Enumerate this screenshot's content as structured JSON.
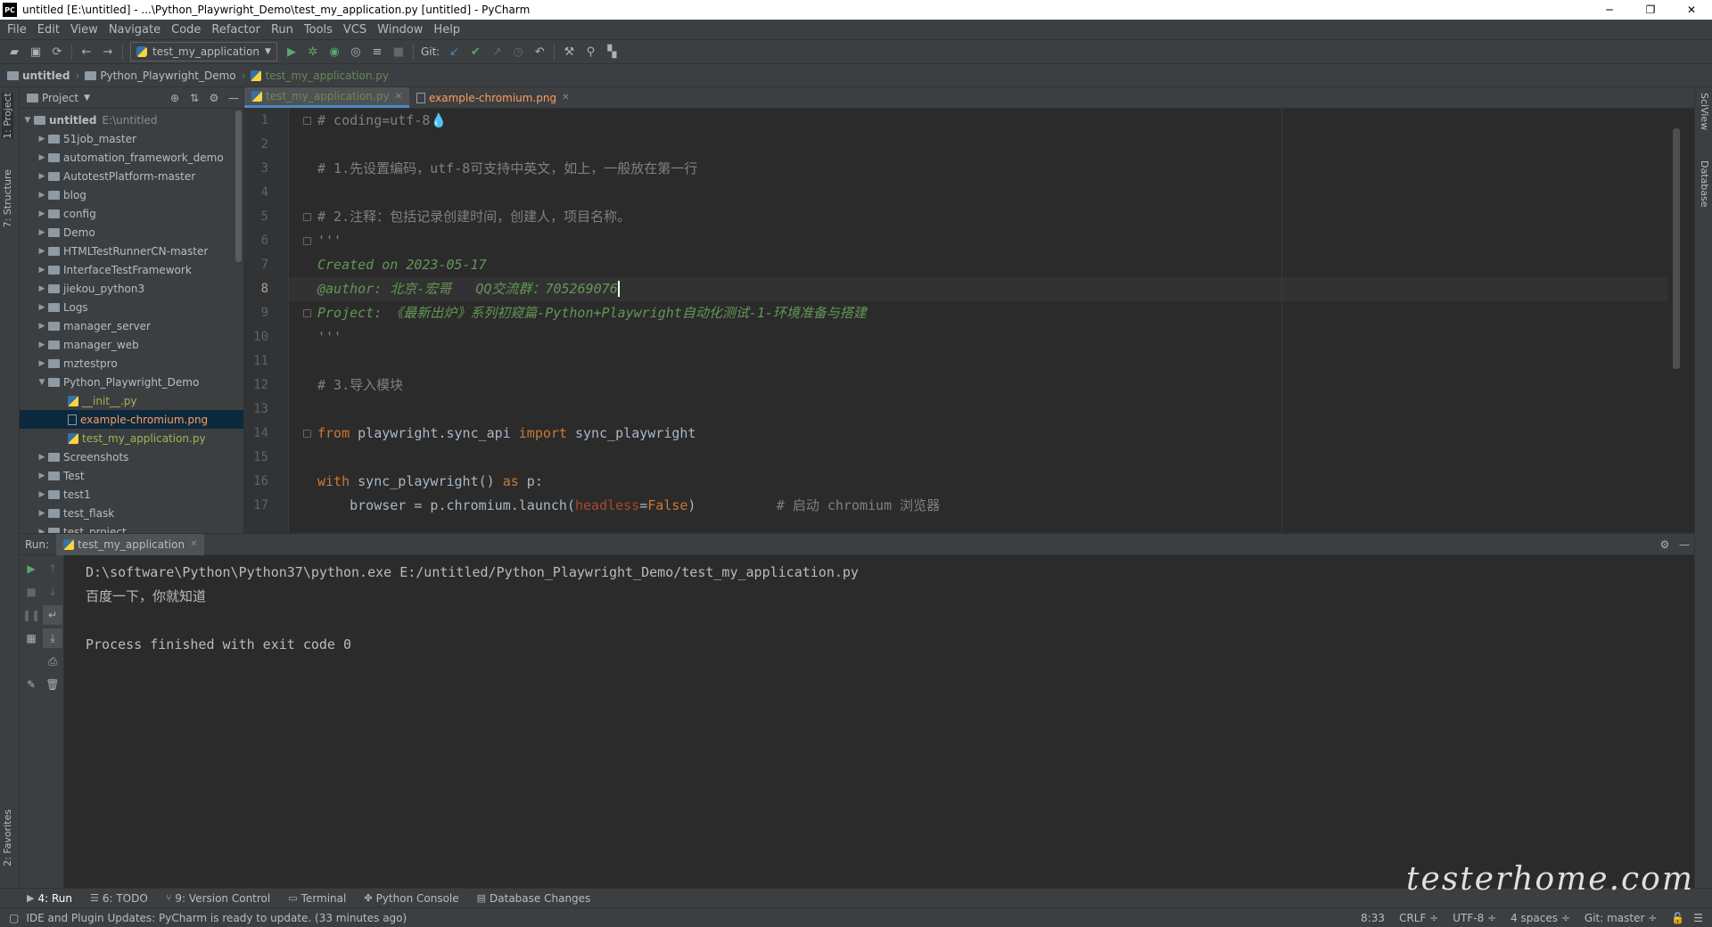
{
  "window": {
    "title": "untitled [E:\\untitled] - ...\\Python_Playwright_Demo\\test_my_application.py [untitled] - PyCharm",
    "icon_text": "PC",
    "minimize": "─",
    "maximize": "❐",
    "close": "✕"
  },
  "menu": [
    "File",
    "Edit",
    "View",
    "Navigate",
    "Code",
    "Refactor",
    "Run",
    "Tools",
    "VCS",
    "Window",
    "Help"
  ],
  "toolbar": {
    "run_config": "test_my_application",
    "git_label": "Git:"
  },
  "breadcrumb": [
    "untitled",
    "Python_Playwright_Demo",
    "test_my_application.py"
  ],
  "left_strip": {
    "project": "1: Project",
    "structure": "7: Structure",
    "favorites": "2: Favorites"
  },
  "right_strip": {
    "sciview": "SciView",
    "database": "Database"
  },
  "project_panel": {
    "title": "Project",
    "root": {
      "name": "untitled",
      "path": "E:\\untitled"
    },
    "items": [
      "51job_master",
      "automation_framework_demo",
      "AutotestPlatform-master",
      "blog",
      "config",
      "Demo",
      "HTMLTestRunnerCN-master",
      "InterfaceTestFramework",
      "jiekou_python3",
      "Logs",
      "manager_server",
      "manager_web",
      "mztestpro",
      "Python_Playwright_Demo"
    ],
    "children": [
      "__init__.py",
      "example-chromium.png",
      "test_my_application.py"
    ],
    "items_after": [
      "Screenshots",
      "Test",
      "test1",
      "test_flask",
      "test_project"
    ]
  },
  "editor": {
    "tabs": [
      {
        "label": "test_my_application.py",
        "close": "✕"
      },
      {
        "label": "example-chromium.png",
        "close": "✕"
      }
    ],
    "line_numbers": [
      "1",
      "2",
      "3",
      "4",
      "5",
      "6",
      "7",
      "8",
      "9",
      "10",
      "11",
      "12",
      "13",
      "14",
      "15",
      "16",
      "17"
    ],
    "lines": {
      "l1": "# coding=utf-8",
      "l3": "# 1.先设置编码，utf-8可支持中英文，如上，一般放在第一行",
      "l5": "# 2.注释：包括记录创建时间，创建人，项目名称。",
      "l6": "'''",
      "l7": "Created on 2023-05-17",
      "l8": "@author: 北京-宏哥   QQ交流群：705269076",
      "l9": "Project: 《最新出炉》系列初窥篇-Python+Playwright自动化测试-1-环境准备与搭建",
      "l10": "'''",
      "l12": "# 3.导入模块",
      "l14_from": "from",
      "l14_mod": " playwright.sync_api ",
      "l14_import": "import",
      "l14_name": " sync_playwright",
      "l16_with": "with",
      "l16_call": " sync_playwright() ",
      "l16_as": "as",
      "l16_var": " p:",
      "l17_a": "    browser = p.chromium.launch(",
      "l17_param": "headless",
      "l17_eq": "=",
      "l17_false": "False",
      "l17_b": ")",
      "l17_comment": "          # 启动 chromium 浏览器"
    }
  },
  "run_panel": {
    "label": "Run:",
    "tab": "test_my_application",
    "tab_close": "✕",
    "output": [
      "D:\\software\\Python\\Python37\\python.exe E:/untitled/Python_Playwright_Demo/test_my_application.py",
      "百度一下，你就知道",
      "",
      "Process finished with exit code 0"
    ]
  },
  "bottom_tabs": [
    {
      "icon": "▶",
      "label": "4: Run"
    },
    {
      "icon": "☰",
      "label": "6: TODO"
    },
    {
      "icon": "⑂",
      "label": "9: Version Control"
    },
    {
      "icon": "▭",
      "label": "Terminal"
    },
    {
      "icon": "✤",
      "label": "Python Console"
    },
    {
      "icon": "▤",
      "label": "Database Changes"
    }
  ],
  "status": {
    "message": "IDE and Plugin Updates: PyCharm is ready to update. (33 minutes ago)",
    "position": "8:33",
    "line_sep": "CRLF ÷",
    "encoding": "UTF-8 ÷",
    "indent": "4 spaces ÷",
    "git": "Git: master ÷"
  },
  "watermark": "testerhome.com",
  "colors": {
    "accent": "#4a88c7",
    "background": "#2b2b2b",
    "panel": "#3c3f41",
    "docstring": "#629755",
    "keyword": "#cc7832"
  }
}
